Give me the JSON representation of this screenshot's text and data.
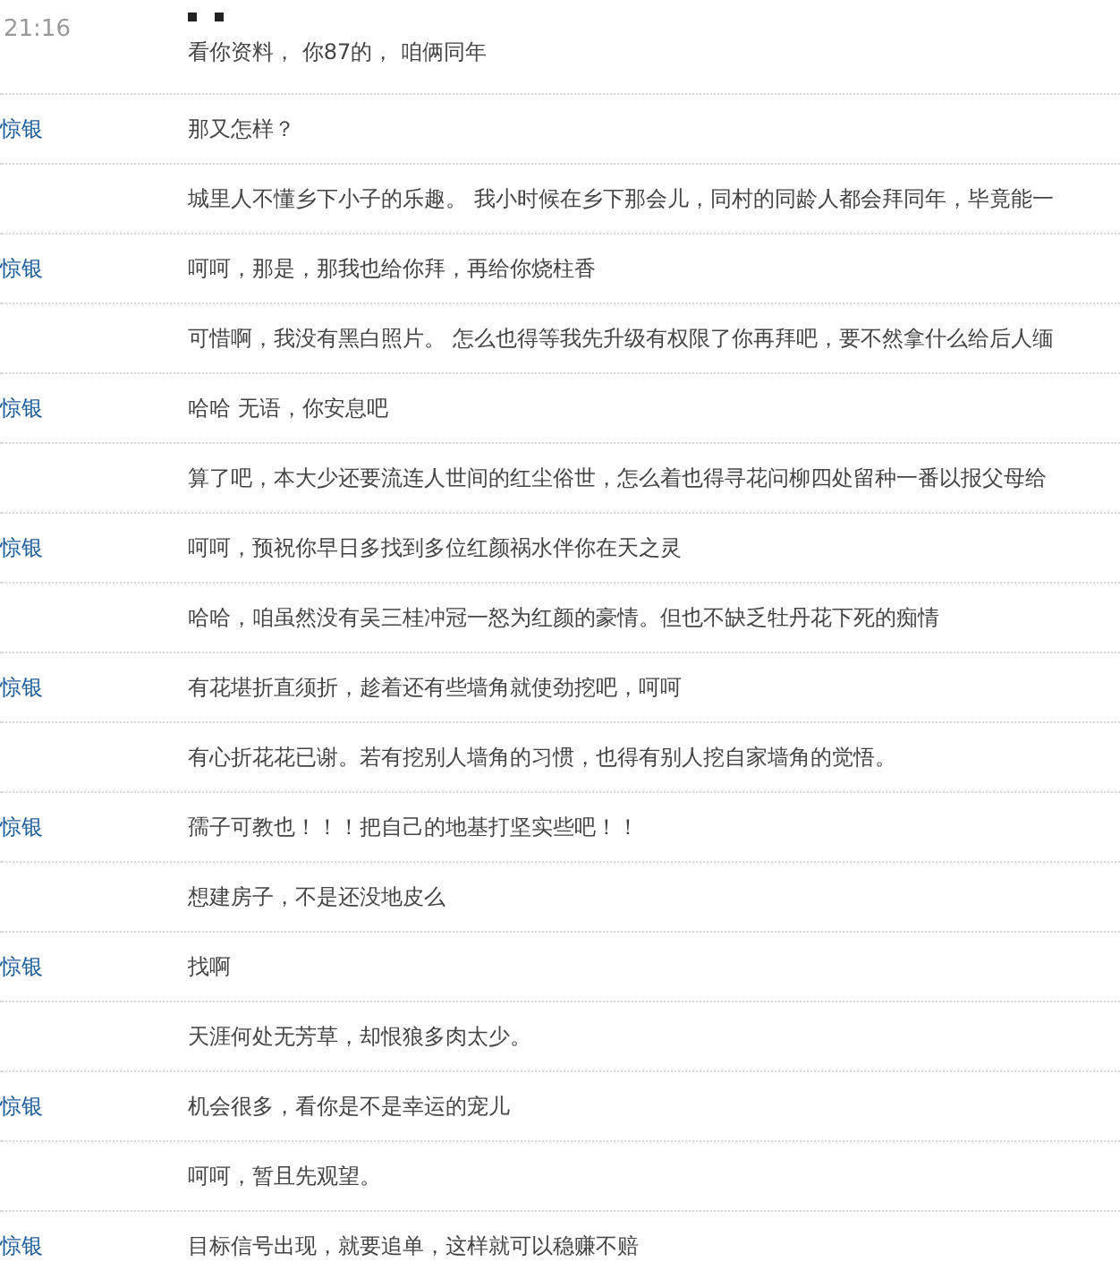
{
  "messages": [
    {
      "time": "21:16",
      "marks": true,
      "text": "看你资料， 你87的， 咱俩同年"
    },
    {
      "author": "惊银",
      "text": "那又怎样？"
    },
    {
      "text": "城里人不懂乡下小子的乐趣。 我小时候在乡下那会儿，同村的同龄人都会拜同年，毕竟能一"
    },
    {
      "author": "惊银",
      "text": "呵呵，那是，那我也给你拜，再给你烧柱香"
    },
    {
      "text": "可惜啊，我没有黑白照片。   怎么也得等我先升级有权限了你再拜吧，要不然拿什么给后人缅"
    },
    {
      "author": "惊银",
      "text": "哈哈 无语，你安息吧"
    },
    {
      "text": "算了吧，本大少还要流连人世间的红尘俗世，怎么着也得寻花问柳四处留种一番以报父母给"
    },
    {
      "author": "惊银",
      "text": "呵呵，预祝你早日多找到多位红颜祸水伴你在天之灵"
    },
    {
      "text": "哈哈，咱虽然没有吴三桂冲冠一怒为红颜的豪情。但也不缺乏牡丹花下死的痴情"
    },
    {
      "author": "惊银",
      "text": "有花堪折直须折，趁着还有些墙角就使劲挖吧，呵呵"
    },
    {
      "text": "有心折花花已谢。若有挖别人墙角的习惯，也得有别人挖自家墙角的觉悟。"
    },
    {
      "author": "惊银",
      "text": "孺子可教也！！！把自己的地基打坚实些吧！！"
    },
    {
      "text": "想建房子，不是还没地皮么"
    },
    {
      "author": "惊银",
      "text": "找啊"
    },
    {
      "text": "天涯何处无芳草，却恨狼多肉太少。"
    },
    {
      "author": "惊银",
      "text": "机会很多，看你是不是幸运的宠儿"
    },
    {
      "text": "呵呵，暂且先观望。"
    },
    {
      "author": "惊银",
      "text": "目标信号出现，就要追单，这样就可以稳赚不赔"
    }
  ]
}
